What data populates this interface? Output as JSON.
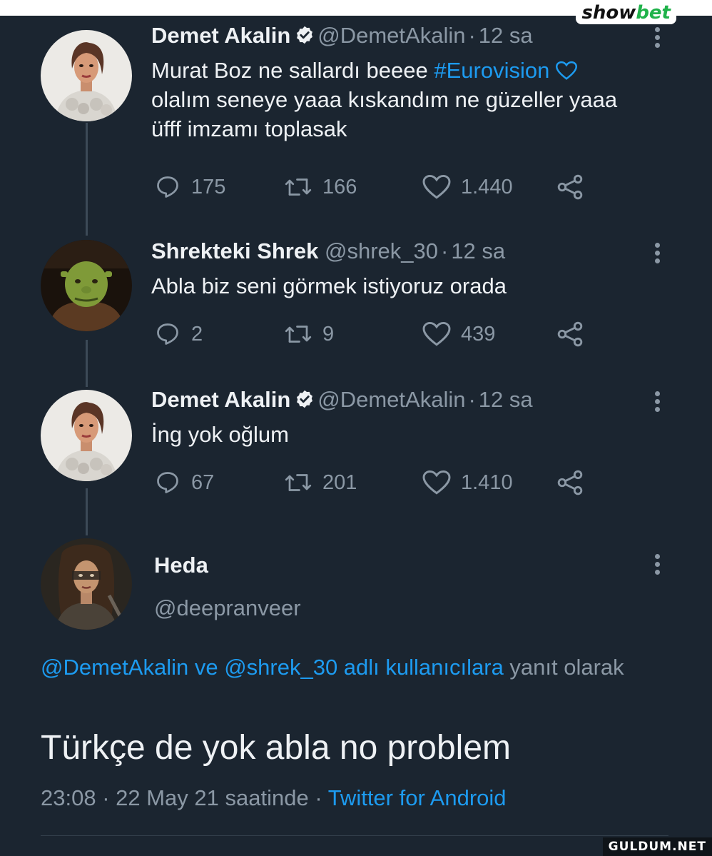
{
  "branding": {
    "logo_part1": "show",
    "logo_part2": "bet",
    "watermark": "GULDUM.NET"
  },
  "tweets": [
    {
      "name": "Demet Akalin",
      "verified": true,
      "handle": "@DemetAkalin",
      "time": "12 sa",
      "text_before": "Murat Boz ne sallardı beeee ",
      "hashtag": "#Eurovision",
      "emoji": "💙",
      "text_after": "olalım seneye yaaa kıskandım ne güzeller yaaa üfff imzamı toplasak",
      "replies": "175",
      "retweets": "166",
      "likes": "1.440"
    },
    {
      "name": "Shrekteki Shrek",
      "verified": false,
      "handle": "@shrek_30",
      "time": "12 sa",
      "text": "Abla biz seni görmek istiyoruz orada",
      "replies": "2",
      "retweets": "9",
      "likes": "439"
    },
    {
      "name": "Demet Akalin",
      "verified": true,
      "handle": "@DemetAkalin",
      "time": "12 sa",
      "text": "İng yok oğlum",
      "replies": "67",
      "retweets": "201",
      "likes": "1.410"
    }
  ],
  "main_tweet": {
    "name": "Heda",
    "handle": "@deepranveer",
    "reply_mention1": "@DemetAkalin",
    "reply_ve": " ve ",
    "reply_mention2": "@shrek_30",
    "reply_suffix_blue": " adlı kullanıcılara",
    "reply_suffix": " yanıt olarak",
    "text": "Türkçe de yok abla no problem",
    "timestamp": "23:08 · 22 May 21 saatinde",
    "separator": " · ",
    "source": "Twitter for Android"
  },
  "colors": {
    "background": "#1b2530",
    "accent": "#1d9bf0",
    "muted": "#8b98a5",
    "brand_green": "#1fb24a"
  },
  "icons": [
    "reply-icon",
    "retweet-icon",
    "like-icon",
    "share-icon",
    "verified-badge-icon",
    "more-options-icon"
  ]
}
